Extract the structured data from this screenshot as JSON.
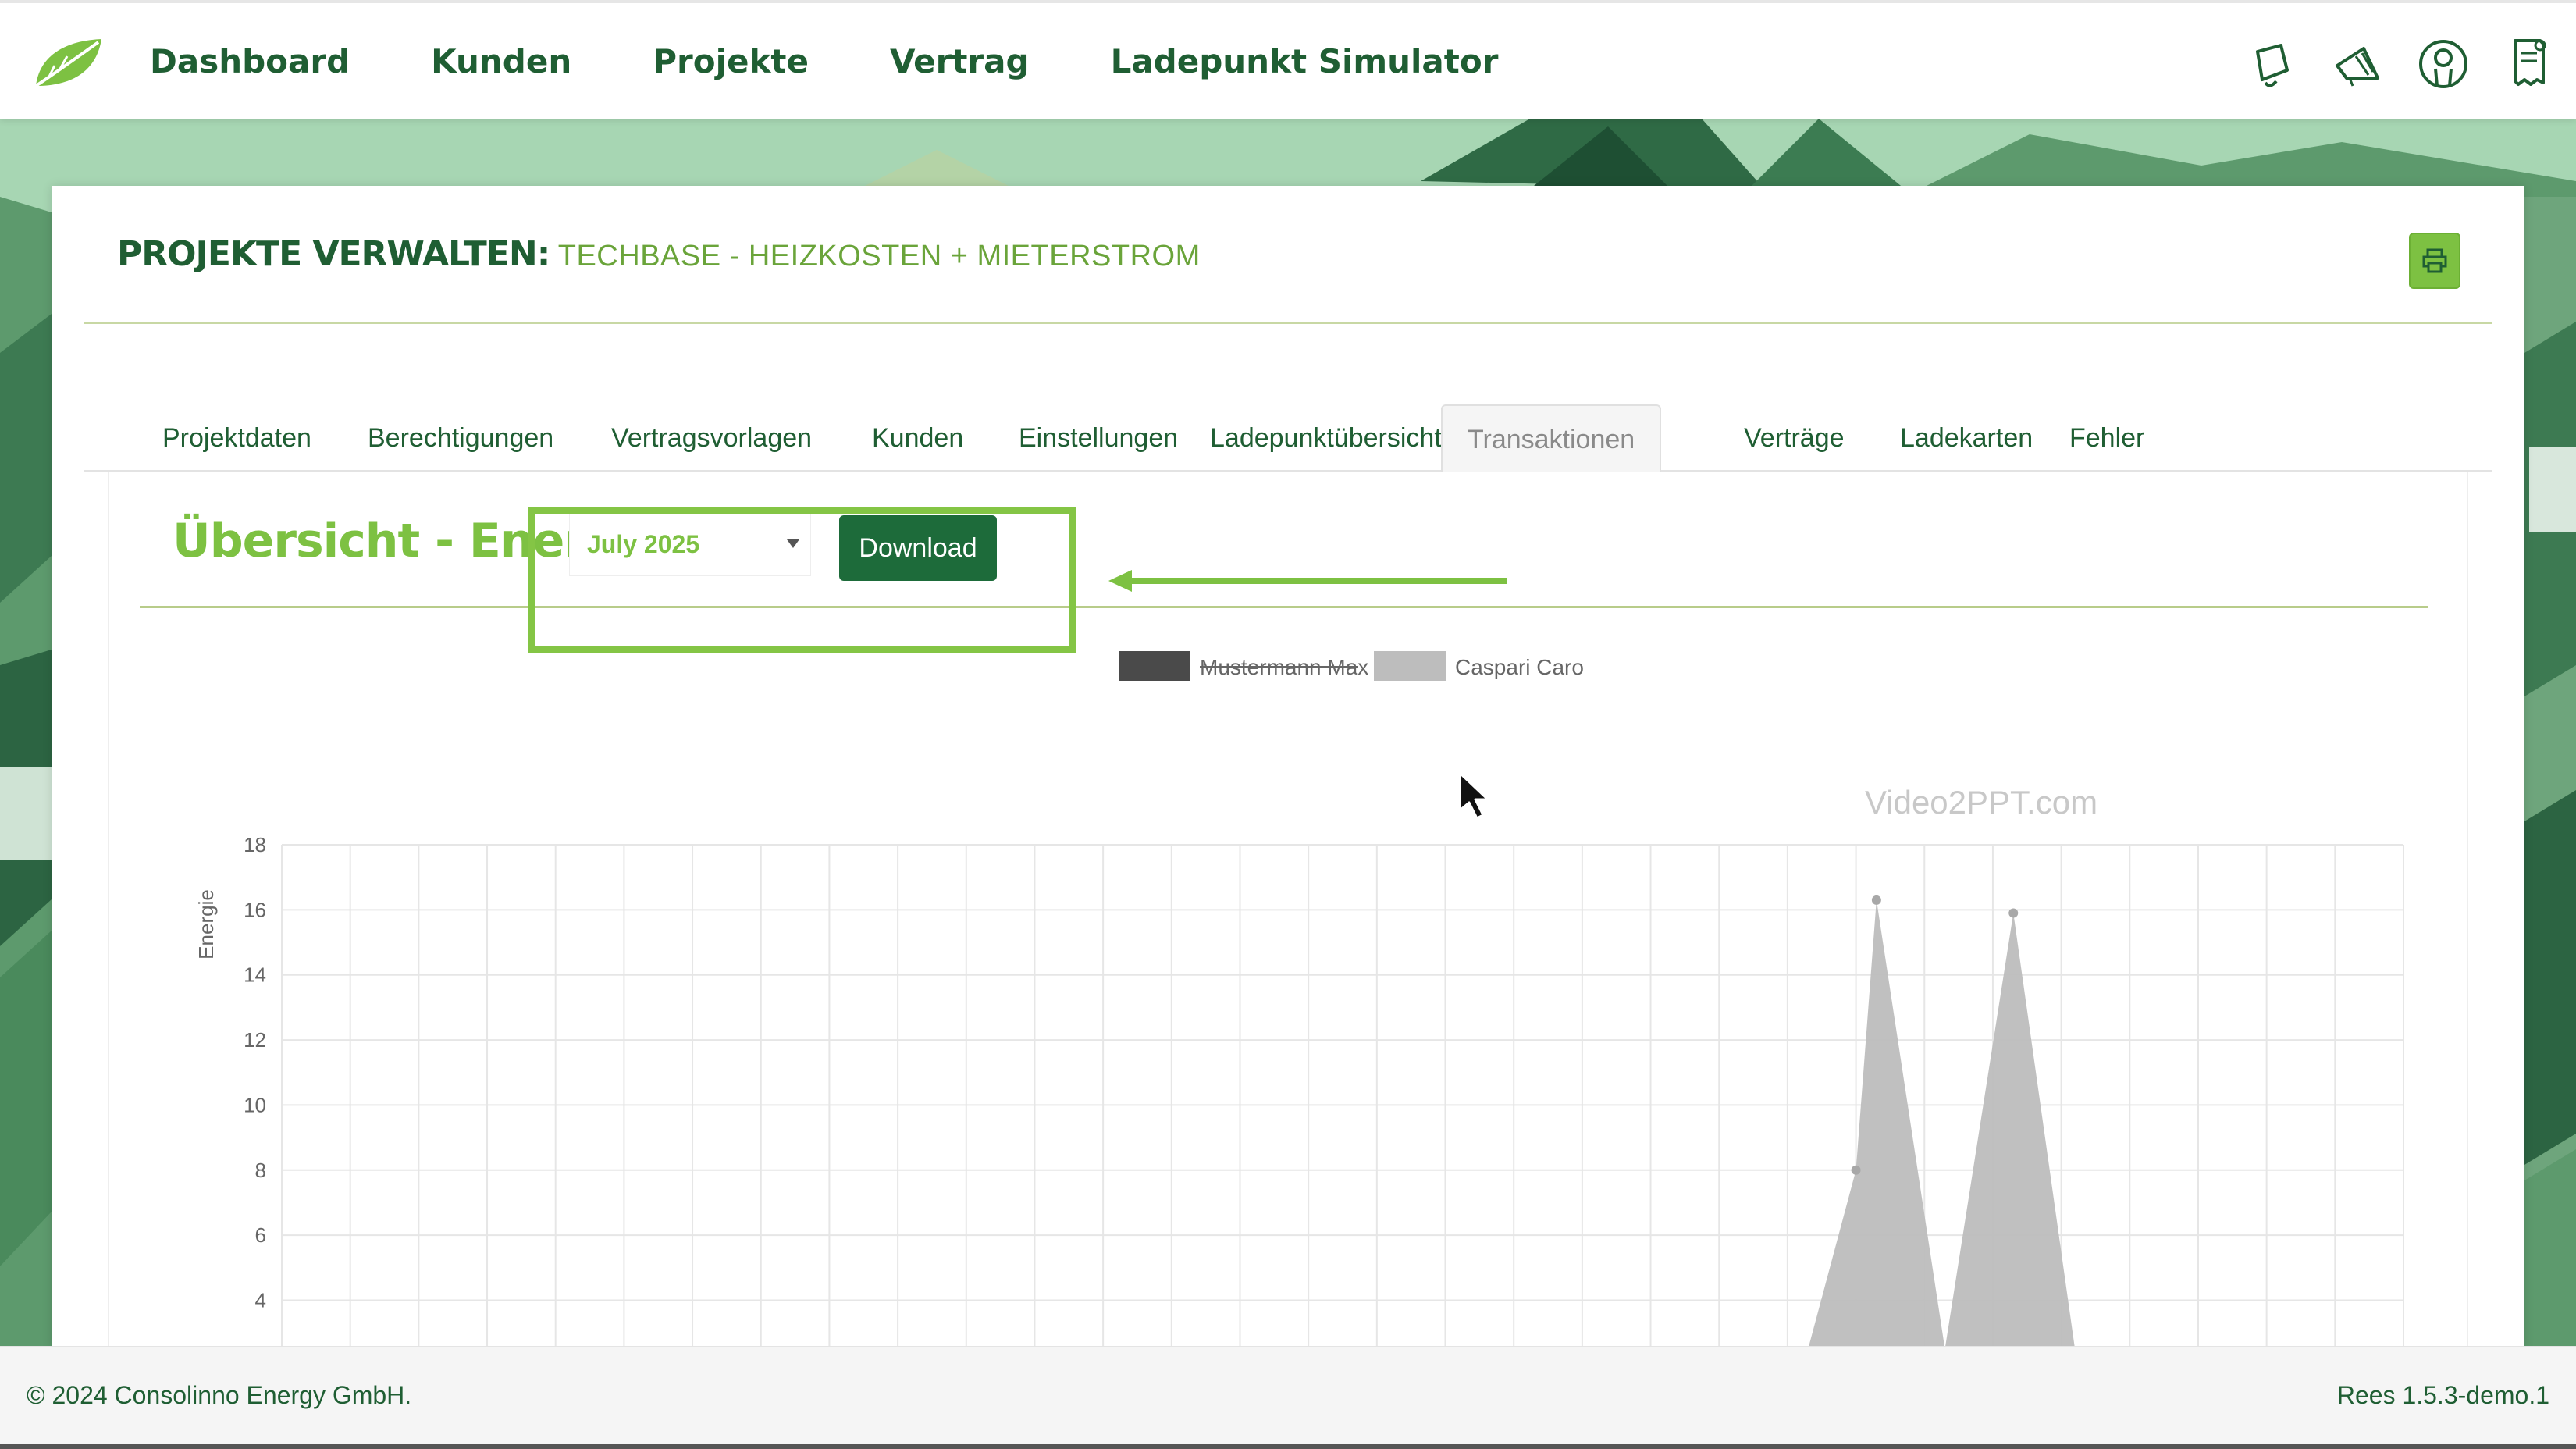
{
  "nav": {
    "items": [
      {
        "label": "Dashboard"
      },
      {
        "label": "Kunden"
      },
      {
        "label": "Projekte"
      },
      {
        "label": "Vertrag"
      },
      {
        "label": "Ladepunkt Simulator"
      }
    ]
  },
  "header_icons": [
    "bell-icon",
    "megaphone-icon",
    "user-avatar-icon",
    "document-icon"
  ],
  "card": {
    "title_main": "PROJEKTE VERWALTEN:",
    "title_sub": "TECHBASE - HEIZKOSTEN + MIETERSTROM"
  },
  "tabs": [
    {
      "label": "Projektdaten"
    },
    {
      "label": "Berechtigungen"
    },
    {
      "label": "Vertragsvorlagen"
    },
    {
      "label": "Kunden"
    },
    {
      "label": "Einstellungen"
    },
    {
      "label": "Ladepunktübersicht"
    },
    {
      "label": "Transaktionen",
      "active": true
    },
    {
      "label": "Verträge"
    },
    {
      "label": "Ladekarten"
    },
    {
      "label": "Fehler"
    }
  ],
  "overview": {
    "title": "Übersicht - Energie",
    "month_selected": "July 2025",
    "download_label": "Download"
  },
  "chart_data": {
    "type": "area",
    "ylabel": "Energie",
    "yticks": [
      4,
      6,
      8,
      10,
      12,
      14,
      16,
      18
    ],
    "ylim": [
      2.5,
      18
    ],
    "x_count": 31,
    "grid": true,
    "legend_position": "top-center",
    "series": [
      {
        "name": "Mustermann Max",
        "hidden": true,
        "color": "#4a4a4a",
        "values": []
      },
      {
        "name": "Caspari Caro",
        "color": "#bdbdbd",
        "values": [
          {
            "x": 22.3,
            "y": 2.5
          },
          {
            "x": 23,
            "y": 8
          },
          {
            "x": 23.3,
            "y": 16.3
          },
          {
            "x": 24.3,
            "y": 2.5
          },
          {
            "x": 25.3,
            "y": 15.9
          },
          {
            "x": 26.2,
            "y": 2.5
          }
        ]
      }
    ],
    "watermark": "Video2PPT.com"
  },
  "footer": {
    "copyright": "© 2024 Consolinno Energy GmbH.",
    "version": "Rees 1.5.3-demo.1"
  },
  "colors": {
    "brand_dark": "#1f5e33",
    "brand_light": "#7dc142",
    "button": "#1d6b3a"
  }
}
